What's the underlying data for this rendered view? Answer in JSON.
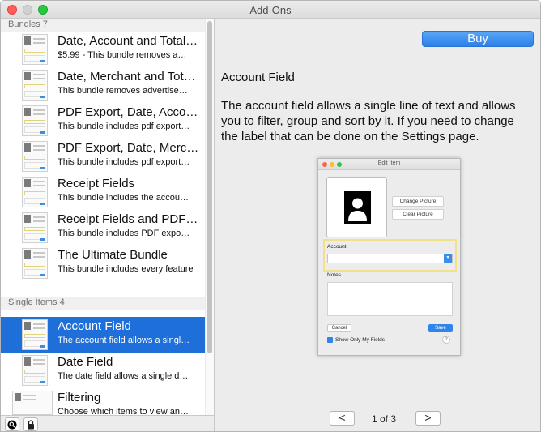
{
  "window": {
    "title": "Add-Ons"
  },
  "sidebar": {
    "sections": [
      {
        "header": "Bundles 7",
        "items": [
          {
            "title": "Date, Account and Total…",
            "subtitle": "$5.99 - This bundle removes a…"
          },
          {
            "title": "Date, Merchant and Tot…",
            "subtitle": "This bundle removes advertise…"
          },
          {
            "title": "PDF Export, Date, Acco…",
            "subtitle": "This bundle includes pdf export…"
          },
          {
            "title": "PDF Export, Date, Merc…",
            "subtitle": "This bundle includes pdf export…"
          },
          {
            "title": "Receipt Fields",
            "subtitle": "This bundle includes the accou…"
          },
          {
            "title": "Receipt Fields and PDF…",
            "subtitle": "This bundle includes PDF expo…"
          },
          {
            "title": "The Ultimate Bundle",
            "subtitle": "This bundle includes every feature"
          }
        ]
      },
      {
        "header": "Single Items 4",
        "items": [
          {
            "title": "Account Field",
            "subtitle": "The account field allows a singl…",
            "selected": true
          },
          {
            "title": "Date Field",
            "subtitle": "The date field allows a single d…"
          },
          {
            "title": "Filtering",
            "subtitle": "Choose which items to view an…"
          }
        ]
      }
    ]
  },
  "detail": {
    "buy_label": "Buy",
    "title": "Account Field",
    "description": "The account field allows a single line of text and allows you to filter, group and sort by it. If you need to change the label that can be done on the Settings page.",
    "screenshot": {
      "window_title": "Edit Item",
      "change_picture": "Change Picture",
      "clear_picture": "Clear Picture",
      "account_label": "Account",
      "notes_label": "Notes",
      "cancel_label": "Cancel",
      "save_label": "Save",
      "checkbox_label": "Show Only My Fields",
      "help_label": "?"
    },
    "pager": {
      "prev": "<",
      "next": ">",
      "label": "1 of 3"
    }
  },
  "colors": {
    "accent": "#1e6fd9",
    "buy": "#2a80ea",
    "highlight": "#f1e28a"
  }
}
